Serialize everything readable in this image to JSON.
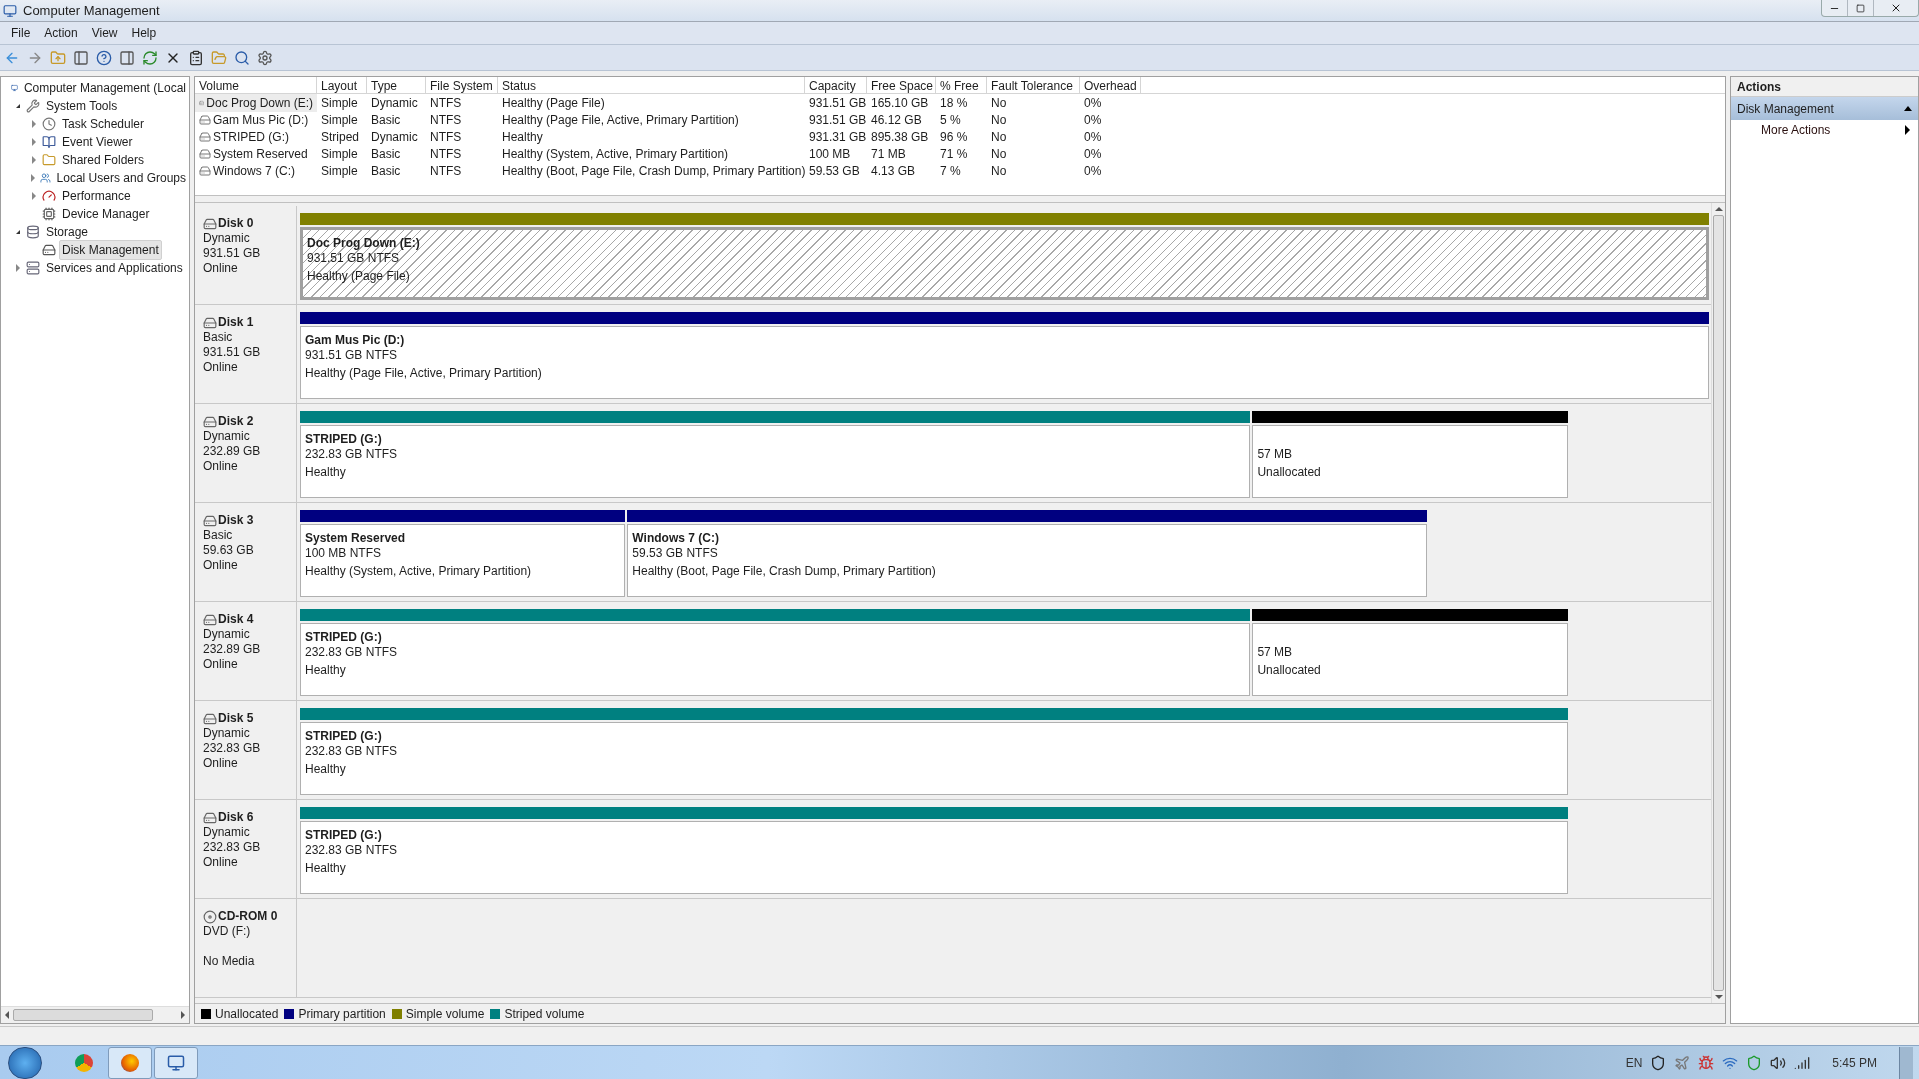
{
  "window": {
    "title": "Computer Management"
  },
  "menu": [
    "File",
    "Action",
    "View",
    "Help"
  ],
  "tree": [
    {
      "label": "Computer Management (Local",
      "kind": "computer",
      "selected": false,
      "children": [
        {
          "label": "System Tools",
          "kind": "tools",
          "expanded": true,
          "selected": false,
          "children": [
            {
              "label": "Task Scheduler",
              "kind": "clock",
              "expanded": false,
              "selected": false
            },
            {
              "label": "Event Viewer",
              "kind": "log",
              "expanded": false,
              "selected": false
            },
            {
              "label": "Shared Folders",
              "kind": "folder",
              "expanded": false,
              "selected": false
            },
            {
              "label": "Local Users and Groups",
              "kind": "users",
              "expanded": false,
              "selected": false
            },
            {
              "label": "Performance",
              "kind": "gauge",
              "expanded": false,
              "selected": false
            },
            {
              "label": "Device Manager",
              "kind": "device",
              "selected": false
            }
          ]
        },
        {
          "label": "Storage",
          "kind": "storage",
          "expanded": true,
          "selected": false,
          "children": [
            {
              "label": "Disk Management",
              "kind": "disk",
              "selected": true
            }
          ]
        },
        {
          "label": "Services and Applications",
          "kind": "services",
          "expanded": false,
          "selected": false
        }
      ]
    }
  ],
  "table": {
    "columns": [
      "Volume",
      "Layout",
      "Type",
      "File System",
      "Status",
      "Capacity",
      "Free Space",
      "% Free",
      "Fault Tolerance",
      "Overhead"
    ],
    "rows": [
      {
        "selected": true,
        "cells": [
          "Doc Prog Down (E:)",
          "Simple",
          "Dynamic",
          "NTFS",
          "Healthy (Page File)",
          "931.51 GB",
          "165.10 GB",
          "18 %",
          "No",
          "0%"
        ]
      },
      {
        "selected": false,
        "cells": [
          "Gam Mus Pic (D:)",
          "Simple",
          "Basic",
          "NTFS",
          "Healthy (Page File, Active, Primary Partition)",
          "931.51 GB",
          "46.12 GB",
          "5 %",
          "No",
          "0%"
        ]
      },
      {
        "selected": false,
        "cells": [
          "STRIPED (G:)",
          "Striped",
          "Dynamic",
          "NTFS",
          "Healthy",
          "931.31 GB",
          "895.38 GB",
          "96 %",
          "No",
          "0%"
        ]
      },
      {
        "selected": false,
        "cells": [
          "System Reserved",
          "Simple",
          "Basic",
          "NTFS",
          "Healthy (System, Active, Primary Partition)",
          "100 MB",
          "71 MB",
          "71 %",
          "No",
          "0%"
        ]
      },
      {
        "selected": false,
        "cells": [
          "Windows 7 (C:)",
          "Simple",
          "Basic",
          "NTFS",
          "Healthy (Boot, Page File, Crash Dump, Primary Partition)",
          "59.53 GB",
          "4.13 GB",
          "7 %",
          "No",
          "0%"
        ]
      }
    ]
  },
  "disks": [
    {
      "name": "Disk 0",
      "kind": "disk",
      "type": "Dynamic",
      "size": "931.51 GB",
      "status": "Online",
      "partitions": [
        {
          "name": "Doc Prog Down  (E:)",
          "size": "931.51 GB NTFS",
          "status": "Healthy (Page File)",
          "color": "#808000",
          "selected": true
        }
      ]
    },
    {
      "name": "Disk 1",
      "kind": "disk",
      "type": "Basic",
      "size": "931.51 GB",
      "status": "Online",
      "partitions": [
        {
          "name": "Gam Mus Pic  (D:)",
          "size": "931.51 GB NTFS",
          "status": "Healthy (Page File, Active, Primary Partition)",
          "color": "#000080",
          "selected": false
        }
      ]
    },
    {
      "name": "Disk 2",
      "kind": "disk",
      "type": "Dynamic",
      "size": "232.89 GB",
      "status": "Online",
      "partitions": [
        {
          "name": "STRIPED  (G:)",
          "size": "232.83 GB NTFS",
          "status": "Healthy",
          "color": "#008080",
          "selected": false
        },
        {
          "size": "57 MB",
          "status": "Unallocated",
          "color": "#000000",
          "selected": false
        }
      ]
    },
    {
      "name": "Disk 3",
      "kind": "disk",
      "type": "Basic",
      "size": "59.63 GB",
      "status": "Online",
      "partitions": [
        {
          "name": "System Reserved",
          "size": "100 MB NTFS",
          "status": "Healthy (System, Active, Primary Partition)",
          "color": "#000080",
          "selected": false
        },
        {
          "name": "Windows 7  (C:)",
          "size": "59.53 GB NTFS",
          "status": "Healthy (Boot, Page File, Crash Dump, Primary Partition)",
          "color": "#000080",
          "selected": false
        }
      ]
    },
    {
      "name": "Disk 4",
      "kind": "disk",
      "type": "Dynamic",
      "size": "232.89 GB",
      "status": "Online",
      "partitions": [
        {
          "name": "STRIPED  (G:)",
          "size": "232.83 GB NTFS",
          "status": "Healthy",
          "color": "#008080",
          "selected": false
        },
        {
          "size": "57 MB",
          "status": "Unallocated",
          "color": "#000000",
          "selected": false
        }
      ]
    },
    {
      "name": "Disk 5",
      "kind": "disk",
      "type": "Dynamic",
      "size": "232.83 GB",
      "status": "Online",
      "partitions": [
        {
          "name": "STRIPED  (G:)",
          "size": "232.83 GB NTFS",
          "status": "Healthy",
          "color": "#008080",
          "selected": false
        }
      ]
    },
    {
      "name": "Disk 6",
      "kind": "disk",
      "type": "Dynamic",
      "size": "232.83 GB",
      "status": "Online",
      "partitions": [
        {
          "name": "STRIPED  (G:)",
          "size": "232.83 GB NTFS",
          "status": "Healthy",
          "color": "#008080",
          "selected": false
        }
      ]
    },
    {
      "name": "CD-ROM 0",
      "kind": "cdrom",
      "type": "DVD (F:)",
      "status": "No Media"
    }
  ],
  "legend": [
    {
      "label": "Unallocated",
      "color": "#000000"
    },
    {
      "label": "Primary partition",
      "color": "#000080"
    },
    {
      "label": "Simple volume",
      "color": "#808000"
    },
    {
      "label": "Striped volume",
      "color": "#008080"
    }
  ],
  "actions": {
    "title": "Actions",
    "groups": [
      {
        "label": "Disk Management",
        "expanded": true,
        "items": [
          "More Actions"
        ]
      }
    ]
  },
  "taskbar": {
    "apps": [
      {
        "kind": "chrome",
        "running": false
      },
      {
        "kind": "firefox",
        "running": true
      },
      {
        "kind": "console",
        "running": true
      }
    ],
    "language": "EN",
    "clock": "5:45 PM"
  }
}
